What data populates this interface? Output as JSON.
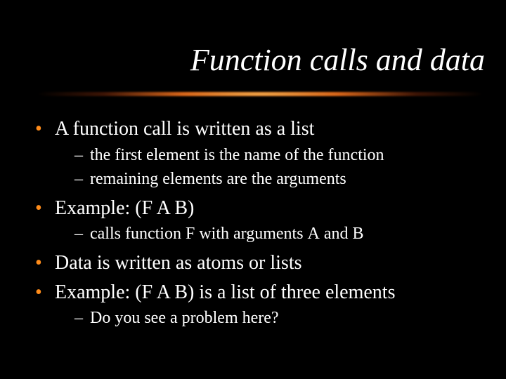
{
  "title": "Function calls and data",
  "bullets": {
    "b1": "A function call is written as a list",
    "b1s1": "the first element is the name of the function",
    "b1s2": "remaining elements are the arguments",
    "b2_pre": "Example: ",
    "b2_code": "(F A B)",
    "b2s1_a": "calls function ",
    "b2s1_F": "F",
    "b2s1_b": " with arguments ",
    "b2s1_A": "A",
    "b2s1_c": " and ",
    "b2s1_B": "B",
    "b3": "Data is written as atoms or lists",
    "b4_pre": "Example: ",
    "b4_code": "(F A B)",
    "b4_post": " is a list of three elements",
    "b4s1": "Do you see a problem here?"
  }
}
